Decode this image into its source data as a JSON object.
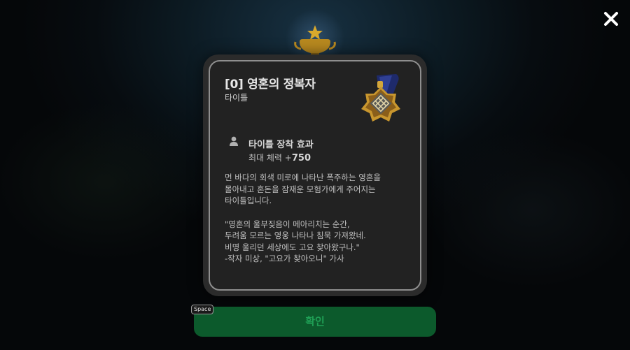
{
  "modal": {
    "title": "[0] 영혼의 정복자",
    "subtitle": "타이틀",
    "effect_title": "타이틀 장착 효과",
    "effect_label": "최대 체력 +",
    "effect_value": "750",
    "description_lines": [
      "먼 바다의 회색 미로에 나타난 폭주하는 영혼을",
      "몰아내고 혼돈을 잠재운 모험가에게 주어지는",
      "타이틀입니다."
    ],
    "quote_lines": [
      "\"영혼의 울부짖음이 메아리치는 순간,",
      " 두려움 모르는 영웅 나타나 침묵 가져왔네.",
      " 비명 울리던 세상에도 고요 찾아왔구나.\"",
      "-작자 미상, \"고요가 찾아오니\" 가사"
    ]
  },
  "confirm": {
    "label": "확인",
    "key_hint": "Space"
  },
  "icons": {
    "close": "close-icon",
    "trophy": "trophy-icon",
    "medal": "medal-icon",
    "user": "user-icon"
  },
  "colors": {
    "confirm_bg": "#0c5a2c",
    "confirm_text": "#1f9f55",
    "modal_border": "#8e8e8e"
  }
}
